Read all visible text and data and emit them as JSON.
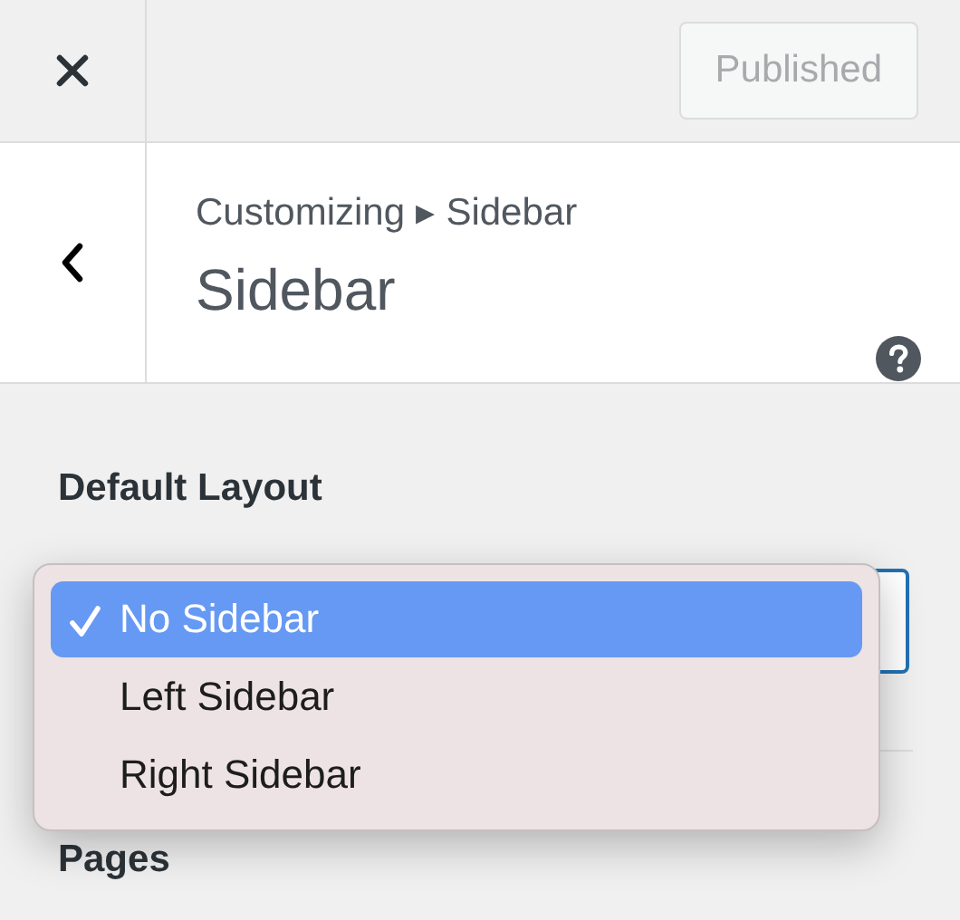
{
  "publish_button": {
    "label": "Published",
    "disabled": true
  },
  "breadcrumb": "Customizing ▸ Sidebar",
  "title": "Sidebar",
  "section": {
    "label": "Default Layout",
    "options": [
      {
        "label": "No Sidebar",
        "selected": true
      },
      {
        "label": "Left Sidebar",
        "selected": false
      },
      {
        "label": "Right Sidebar",
        "selected": false
      }
    ]
  },
  "next_section": "Pages"
}
